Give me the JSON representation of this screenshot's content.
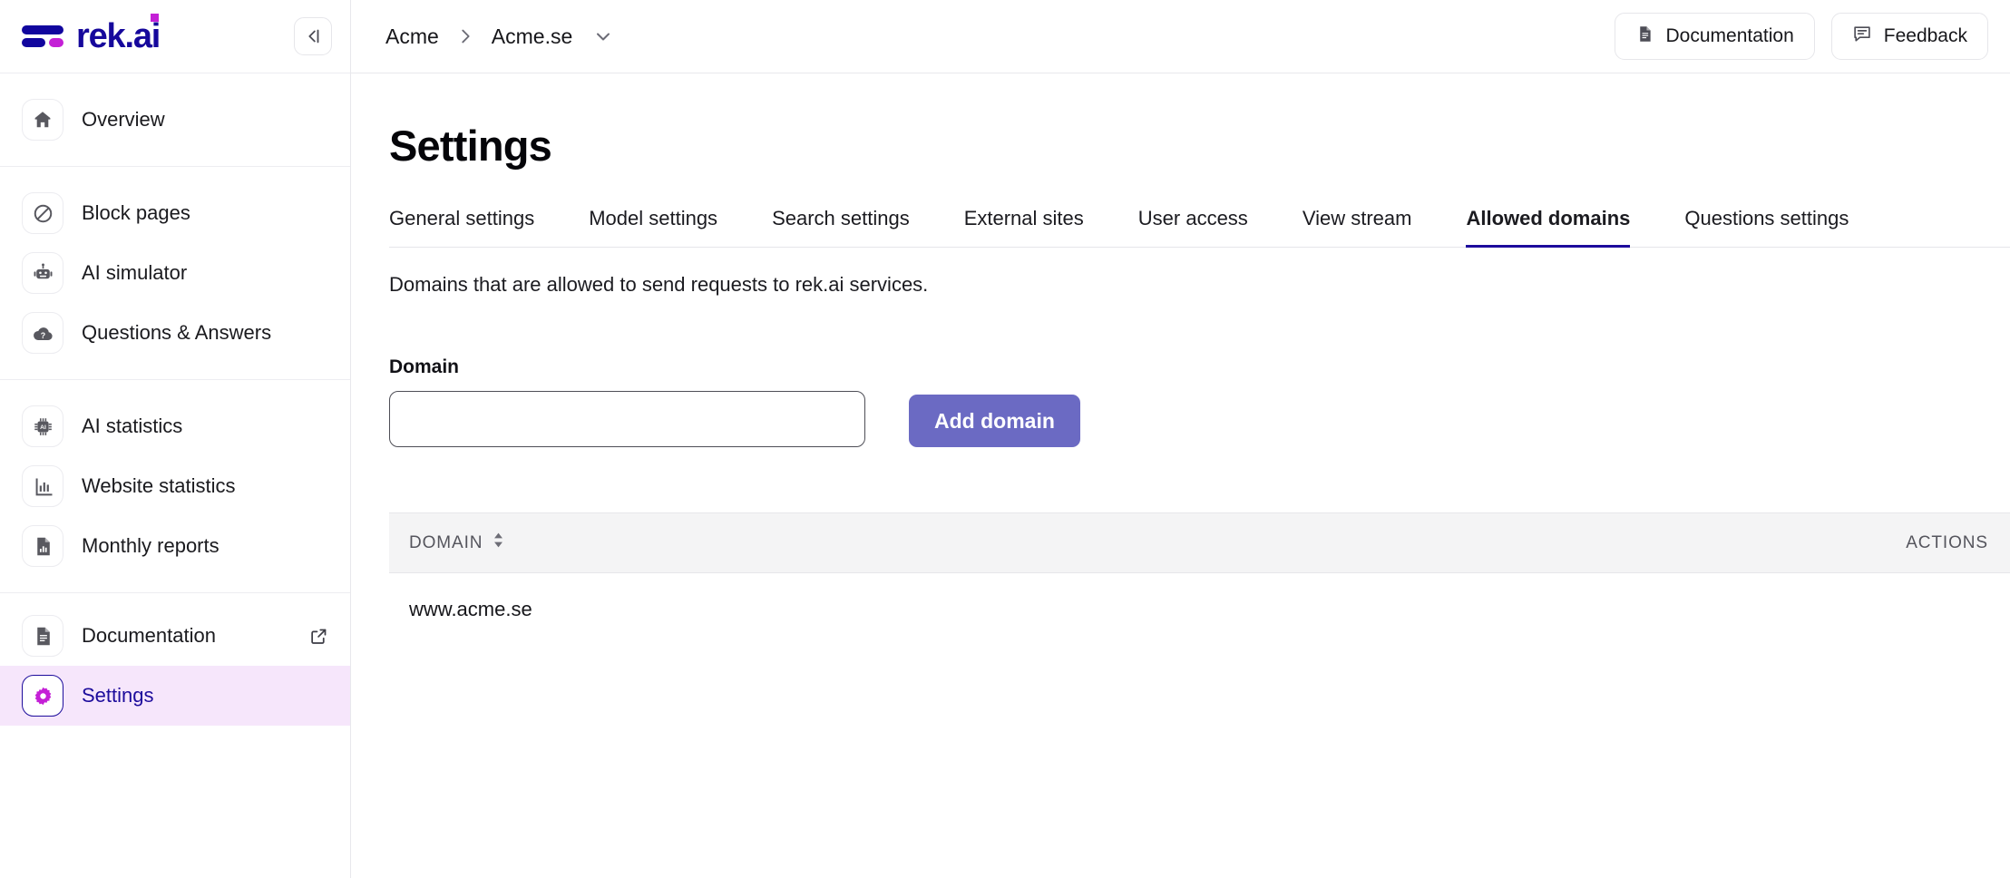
{
  "brand": {
    "name": "rek.ai",
    "logo_icon": "rek-logo-mark",
    "navy": "#16089c",
    "magenta": "#c420d6"
  },
  "sidebar": {
    "collapse_icon": "collapse-sidebar-icon",
    "groups": [
      {
        "items": [
          {
            "label": "Overview",
            "icon": "home-icon",
            "active": false,
            "external": false
          }
        ]
      },
      {
        "items": [
          {
            "label": "Block pages",
            "icon": "block-icon",
            "active": false,
            "external": false
          },
          {
            "label": "AI simulator",
            "icon": "robot-icon",
            "active": false,
            "external": false
          },
          {
            "label": "Questions & Answers",
            "icon": "question-cloud-icon",
            "active": false,
            "external": false
          }
        ]
      },
      {
        "items": [
          {
            "label": "AI statistics",
            "icon": "ai-chip-icon",
            "active": false,
            "external": false
          },
          {
            "label": "Website statistics",
            "icon": "bar-chart-icon",
            "active": false,
            "external": false
          },
          {
            "label": "Monthly reports",
            "icon": "report-document-icon",
            "active": false,
            "external": false
          }
        ]
      },
      {
        "items": [
          {
            "label": "Documentation",
            "icon": "document-icon",
            "active": false,
            "external": true,
            "external_icon": "external-link-icon"
          },
          {
            "label": "Settings",
            "icon": "gear-icon",
            "active": true,
            "external": false
          }
        ]
      }
    ]
  },
  "topbar": {
    "breadcrumb": [
      {
        "label": "Acme"
      },
      {
        "label": "Acme.se"
      }
    ],
    "breadcrumb_separator_icon": "chevron-right-icon",
    "breadcrumb_dropdown_icon": "chevron-down-icon",
    "buttons": [
      {
        "label": "Documentation",
        "icon": "document-icon"
      },
      {
        "label": "Feedback",
        "icon": "chat-bubble-icon"
      }
    ]
  },
  "page": {
    "title": "Settings",
    "tabs": [
      {
        "label": "General settings",
        "active": false
      },
      {
        "label": "Model settings",
        "active": false
      },
      {
        "label": "Search settings",
        "active": false
      },
      {
        "label": "External sites",
        "active": false
      },
      {
        "label": "User access",
        "active": false
      },
      {
        "label": "View stream",
        "active": false
      },
      {
        "label": "Allowed domains",
        "active": true
      },
      {
        "label": "Questions settings",
        "active": false
      }
    ],
    "description": "Domains that are allowed to send requests to rek.ai services."
  },
  "form": {
    "domain_label": "Domain",
    "domain_value": "",
    "domain_placeholder": "",
    "add_button_label": "Add domain",
    "add_button_color": "#6b6ac3"
  },
  "table": {
    "columns": [
      {
        "key": "domain",
        "label": "DOMAIN",
        "sortable": true,
        "sort_icon": "sort-arrows-icon"
      },
      {
        "key": "actions",
        "label": "ACTIONS",
        "sortable": false
      }
    ],
    "rows": [
      {
        "domain": "www.acme.se",
        "actions": ""
      }
    ]
  }
}
